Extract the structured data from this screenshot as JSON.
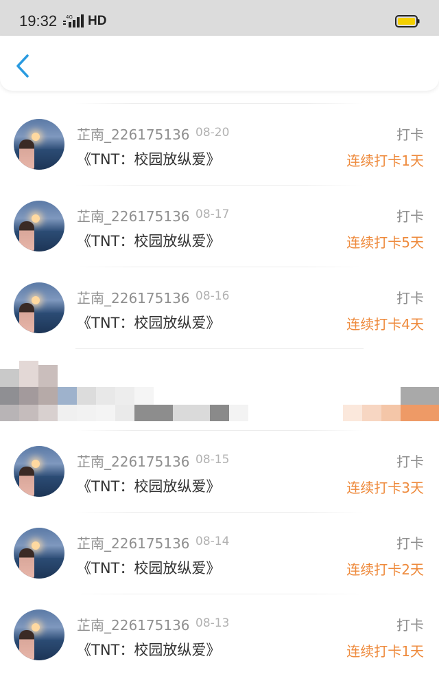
{
  "status_bar": {
    "time": "19:32",
    "network": "HD",
    "signal_label": "4G"
  },
  "nav": {
    "back_icon": "chevron-left-icon"
  },
  "colors": {
    "accent": "#2a9be0",
    "streak": "#ee8a3c",
    "battery": "#f4d000"
  },
  "list": [
    {
      "username": "芷南_226175136",
      "date": "08-20",
      "title": "《TNT：校园放纵爱》",
      "tag": "打卡",
      "streak": "连续打卡1天"
    },
    {
      "username": "芷南_226175136",
      "date": "08-17",
      "title": "《TNT：校园放纵爱》",
      "tag": "打卡",
      "streak": "连续打卡5天"
    },
    {
      "username": "芷南_226175136",
      "date": "08-16",
      "title": "《TNT：校园放纵爱》",
      "tag": "打卡",
      "streak": "连续打卡4天"
    },
    {
      "username": "芷南_226175136",
      "date": "08-15",
      "title": "《TNT：校园放纵爱》",
      "tag": "打卡",
      "streak": "连续打卡3天"
    },
    {
      "username": "芷南_226175136",
      "date": "08-14",
      "title": "《TNT：校园放纵爱》",
      "tag": "打卡",
      "streak": "连续打卡2天"
    },
    {
      "username": "芷南_226175136",
      "date": "08-13",
      "title": "《TNT：校园放纵爱》",
      "tag": "打卡",
      "streak": "连续打卡1天"
    }
  ]
}
